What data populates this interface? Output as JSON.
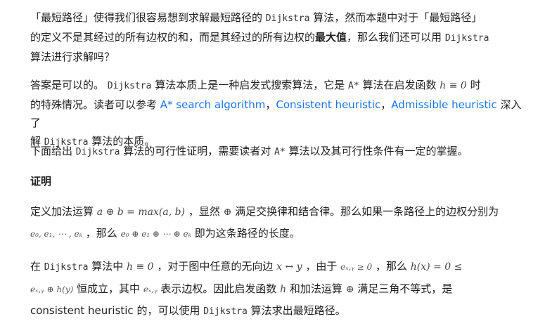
{
  "p1": {
    "t1": "「最短路径」使得我们很容易想到求解最短路径的",
    "code1": "Dijkstra",
    "t2": "算法，然而本题中对于「最短路径」",
    "t3": "的定义不是其经过的所有边权的和，而是其经过的所有边权的",
    "bold1": "最大值",
    "t4": "，那么我们还可以用",
    "code2": "Dijkstra",
    "t5": "算法进行求解吗？"
  },
  "p2": {
    "t1": "答案是可以的。",
    "code1": "Dijkstra",
    "t2": "算法本质上是一种启发式搜索算法，它是",
    "code2": "A*",
    "t3": "算法在启发函数",
    "math1": "h ≡ 0",
    "t4": "时",
    "t5": "的特殊情况。读者可以参考",
    "link1": "A* search algorithm",
    "sep1": "，",
    "link2": "Consistent heuristic",
    "sep2": "，",
    "link3": "Admissible heuristic",
    "t6": "深入了",
    "t7": "解",
    "code3": "Dijkstra",
    "t8": "算法的本质。"
  },
  "p3": {
    "t1": "下面给出",
    "code1": "Dijkstra",
    "t2": "算法的可行性证明，需要读者对",
    "code2": "A*",
    "t3": "算法以及其可行性条件有一定的掌握。"
  },
  "heading": "证明",
  "p4": {
    "t1": "定义加法运算",
    "math1": "a ⊕ b = max(a, b)",
    "t2": "，显然",
    "math2": "⊕",
    "t3": "满足交换律和结合律。那么如果一条路径上的边权分别为",
    "math3": "e₀, e₁, ⋯ , eₖ",
    "t4": "，那么",
    "math4": "e₀ ⊕ e₁ ⊕ ⋯ ⊕ eₖ",
    "t5": "即为这条路径的长度。"
  },
  "p5": {
    "t1": "在",
    "code1": "Dijkstra",
    "t2": "算法中",
    "math1": "h ≡ 0",
    "t3": "，对于图中任意的无向边",
    "math2": "x ↔ y",
    "t4": "，由于",
    "math3": "eₓ,ᵧ ≥ 0",
    "t5": "，那么",
    "math4": "h(x) = 0 ≤",
    "math5": "eₓ,ᵧ ⊕ h(y)",
    "t6": "恒成立，其中",
    "math6": "eₓ,ᵧ",
    "t7": "表示边权。因此启发函数",
    "math7": "h",
    "t8": "和加法运算",
    "math8": "⊕",
    "t9": "满足三角不等式，是",
    "t10": "consistent heuristic 的，可以使用",
    "code2": "Dijkstra",
    "t11": "算法求出最短路径。"
  }
}
